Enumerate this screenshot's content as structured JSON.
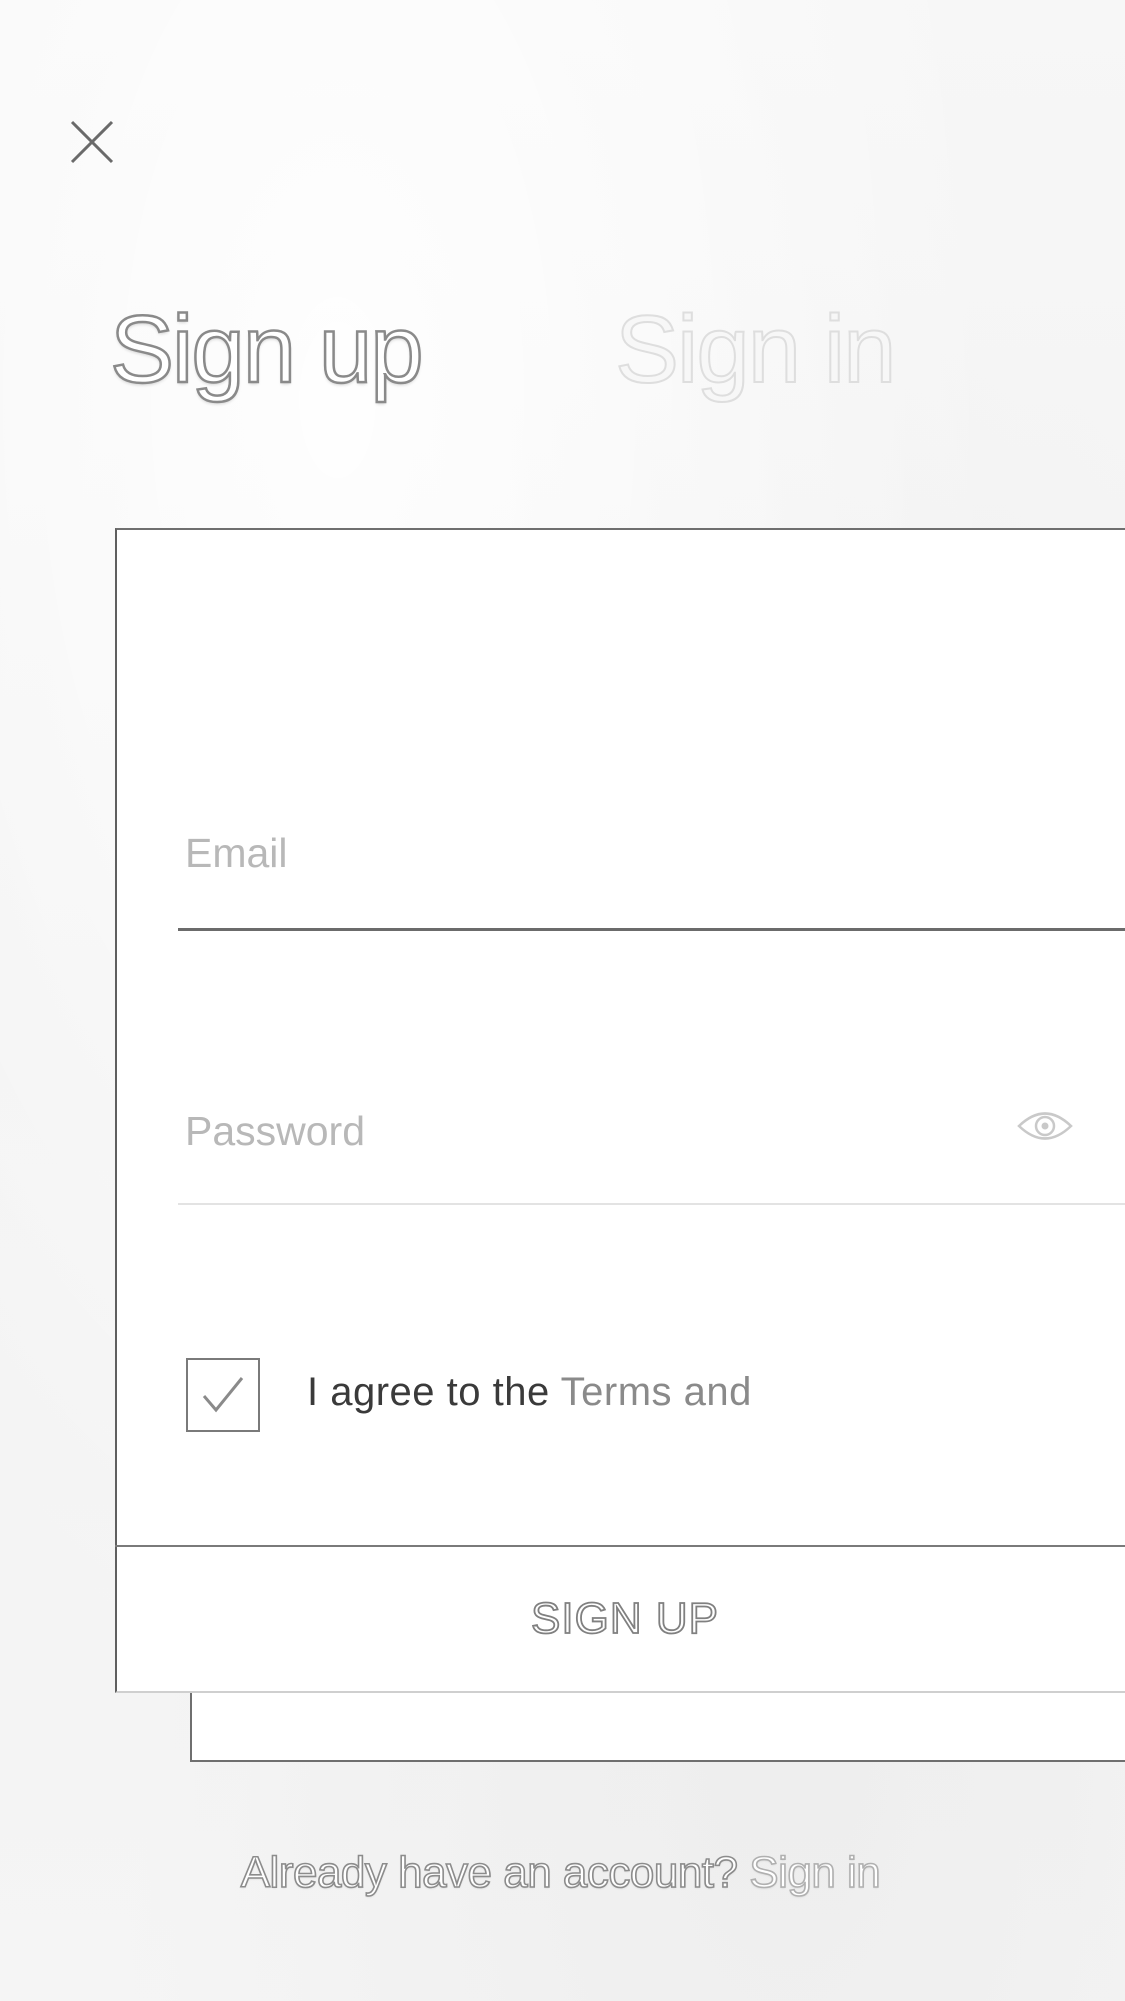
{
  "header": {
    "close_icon": "close-icon"
  },
  "tabs": {
    "sign_up": "Sign up",
    "sign_in": "Sign in"
  },
  "form": {
    "email": {
      "placeholder": "Email",
      "value": ""
    },
    "password": {
      "placeholder": "Password",
      "value": "",
      "toggle_icon": "eye-icon"
    },
    "terms": {
      "checked": true,
      "prefix": "I agree to the ",
      "link": "Terms and"
    },
    "submit_label": "SIGN UP"
  },
  "footer": {
    "prompt": "Already have an account? ",
    "link": "Sign in"
  },
  "colors": {
    "background": "#f4f4f4",
    "card": "#ffffff",
    "border": "#6f6f6f",
    "placeholder": "#b8b8b8",
    "text": "#3a3a3a"
  }
}
